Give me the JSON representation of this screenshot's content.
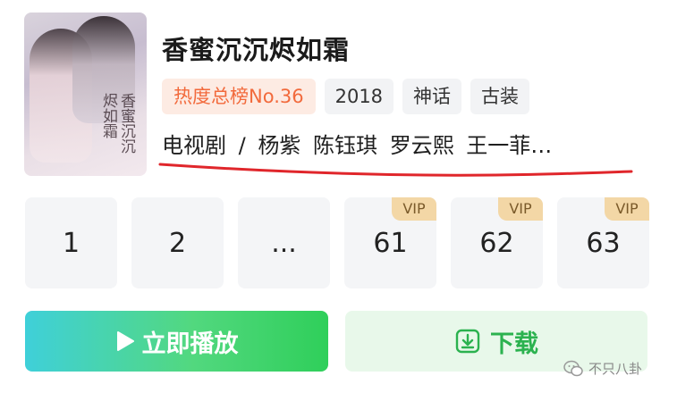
{
  "show": {
    "title": "香蜜沉沉烬如霜",
    "poster_text": "香蜜沉沉烬如霜",
    "tags": [
      "热度总榜No.36",
      "2018",
      "神话",
      "古装"
    ],
    "cast_line": "电视剧 / 杨紫  陈钰琪  罗云熙  王一菲…"
  },
  "episodes": [
    {
      "label": "1",
      "badge": ""
    },
    {
      "label": "2",
      "badge": ""
    },
    {
      "label": "...",
      "badge": ""
    },
    {
      "label": "61",
      "badge": "VIP"
    },
    {
      "label": "62",
      "badge": "VIP"
    },
    {
      "label": "63",
      "badge": "VIP"
    }
  ],
  "actions": {
    "play_label": "立即播放",
    "download_label": "下载"
  },
  "watermark": "不只八卦",
  "colors": {
    "hot_tag": "#f26a3c",
    "play_gradient_start": "#3fd0d9",
    "play_gradient_end": "#2fcf5a",
    "download_text": "#2bb24f",
    "annotation_underline": "#e0262b"
  },
  "icons": [
    "play-icon",
    "download-icon",
    "wechat-watermark-icon"
  ]
}
